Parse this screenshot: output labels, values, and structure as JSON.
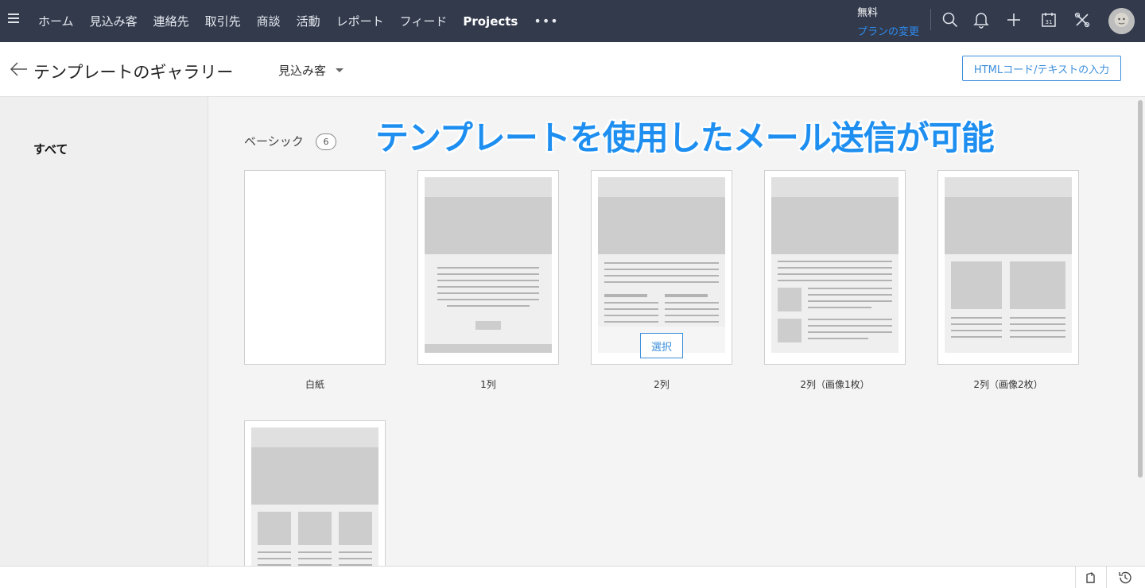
{
  "nav": {
    "items": [
      "ホーム",
      "見込み客",
      "連絡先",
      "取引先",
      "商談",
      "活動",
      "レポート",
      "フィード",
      "Projects"
    ],
    "more": "•••",
    "plan_label": "無料",
    "plan_change": "プランの変更",
    "icons": [
      "search-icon",
      "bell-icon",
      "plus-icon",
      "calendar-icon",
      "tools-icon"
    ],
    "calendar_day": "31"
  },
  "header": {
    "title": "テンプレートのギャラリー",
    "module": "見込み客",
    "html_button": "HTMLコード/テキストの入力"
  },
  "sidebar": {
    "all": "すべて"
  },
  "gallery": {
    "section": "ベーシック",
    "count": "6",
    "banner": "テンプレートを使用したメール送信が可能",
    "select_label": "選択",
    "templates": [
      {
        "label": "白紙"
      },
      {
        "label": "1列"
      },
      {
        "label": "2列"
      },
      {
        "label": "2列（画像1枚）"
      },
      {
        "label": "2列（画像2枚）"
      }
    ]
  },
  "colors": {
    "nav_bg": "#323a4c",
    "accent": "#1e8ff0",
    "button_border": "#3d8fdc"
  }
}
